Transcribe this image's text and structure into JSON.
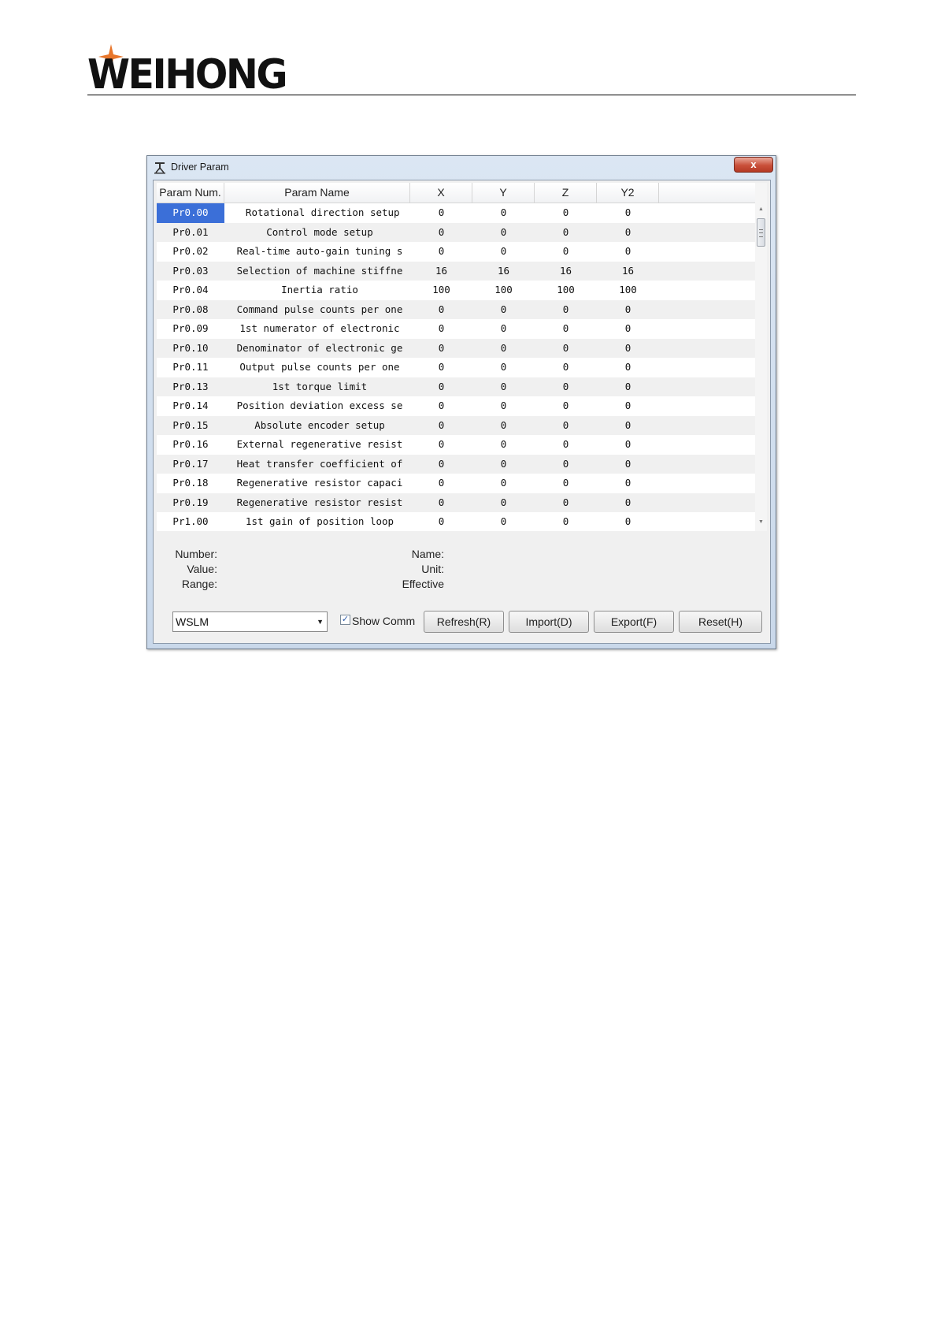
{
  "header": {
    "logo_text": "WEIHONG"
  },
  "window": {
    "title": "Driver Param",
    "close_label": "x"
  },
  "grid": {
    "columns": [
      "Param Num.",
      "Param Name",
      "X",
      "Y",
      "Z",
      "Y2"
    ],
    "selected_row": 0,
    "rows": [
      {
        "num": "Pr0.00",
        "name": " Rotational direction setup",
        "x": "0",
        "y": "0",
        "z": "0",
        "y2": "0"
      },
      {
        "num": "Pr0.01",
        "name": "Control mode setup",
        "x": "0",
        "y": "0",
        "z": "0",
        "y2": "0"
      },
      {
        "num": "Pr0.02",
        "name": "Real-time auto-gain tuning s",
        "x": "0",
        "y": "0",
        "z": "0",
        "y2": "0"
      },
      {
        "num": "Pr0.03",
        "name": "Selection of machine stiffne",
        "x": "16",
        "y": "16",
        "z": "16",
        "y2": "16"
      },
      {
        "num": "Pr0.04",
        "name": "Inertia ratio",
        "x": "100",
        "y": "100",
        "z": "100",
        "y2": "100"
      },
      {
        "num": "Pr0.08",
        "name": "Command pulse counts per one",
        "x": "0",
        "y": "0",
        "z": "0",
        "y2": "0"
      },
      {
        "num": "Pr0.09",
        "name": "1st numerator of electronic",
        "x": "0",
        "y": "0",
        "z": "0",
        "y2": "0"
      },
      {
        "num": "Pr0.10",
        "name": "Denominator of electronic ge",
        "x": "0",
        "y": "0",
        "z": "0",
        "y2": "0"
      },
      {
        "num": "Pr0.11",
        "name": "Output pulse counts per one",
        "x": "0",
        "y": "0",
        "z": "0",
        "y2": "0"
      },
      {
        "num": "Pr0.13",
        "name": "1st torque limit",
        "x": "0",
        "y": "0",
        "z": "0",
        "y2": "0"
      },
      {
        "num": "Pr0.14",
        "name": "Position deviation excess se",
        "x": "0",
        "y": "0",
        "z": "0",
        "y2": "0"
      },
      {
        "num": "Pr0.15",
        "name": "Absolute encoder setup",
        "x": "0",
        "y": "0",
        "z": "0",
        "y2": "0"
      },
      {
        "num": "Pr0.16",
        "name": "External regenerative resist",
        "x": "0",
        "y": "0",
        "z": "0",
        "y2": "0"
      },
      {
        "num": "Pr0.17",
        "name": "Heat transfer coefficient of",
        "x": "0",
        "y": "0",
        "z": "0",
        "y2": "0"
      },
      {
        "num": "Pr0.18",
        "name": "Regenerative resistor capaci",
        "x": "0",
        "y": "0",
        "z": "0",
        "y2": "0"
      },
      {
        "num": "Pr0.19",
        "name": "Regenerative resistor resist",
        "x": "0",
        "y": "0",
        "z": "0",
        "y2": "0"
      },
      {
        "num": "Pr1.00",
        "name": "1st gain of position loop",
        "x": "0",
        "y": "0",
        "z": "0",
        "y2": "0"
      }
    ]
  },
  "info": {
    "number_label": "Number:",
    "value_label": "Value:",
    "range_label": "Range:",
    "name_label": "Name:",
    "unit_label": "Unit:",
    "effective_label": "Effective"
  },
  "controls": {
    "driver_select": "WSLM",
    "show_comment_label": "Show Comm",
    "show_comment_checked": true,
    "refresh_label": "Refresh(R)",
    "import_label": "Import(D)",
    "export_label": "Export(F)",
    "reset_label": "Reset(H)"
  },
  "icons": [
    "star-logo-icon",
    "driver-param-icon",
    "close-icon",
    "scroll-up-icon",
    "scroll-down-icon",
    "dropdown-arrow-icon",
    "checkbox-icon"
  ],
  "colors": {
    "selection": "#3b6fd8",
    "logo_star": "#e8762b",
    "close_button": "#c9503a"
  }
}
